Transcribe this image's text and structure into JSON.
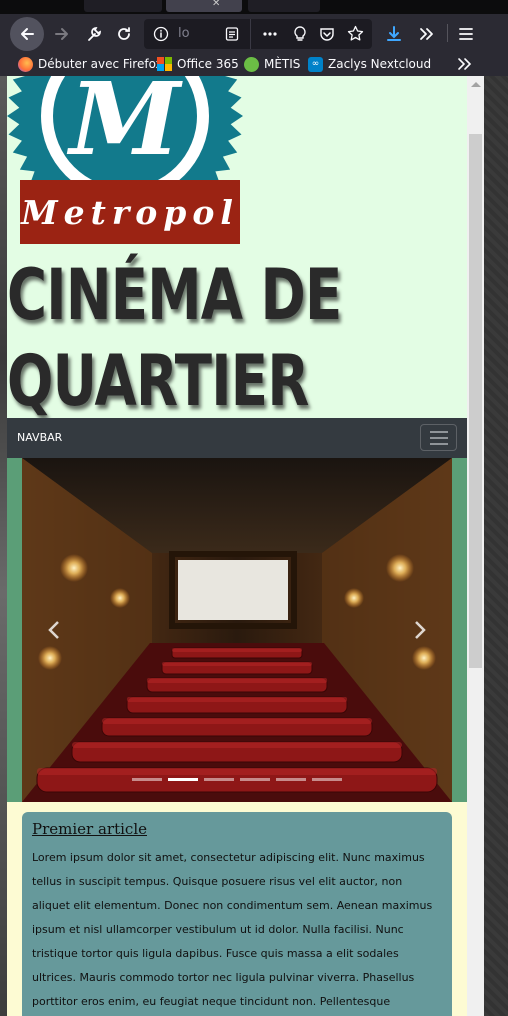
{
  "browser": {
    "url_text": "lo",
    "bookmarks": [
      {
        "label": "Débuter avec Firefox",
        "icon": "firefox-icon",
        "color": "#ff7139"
      },
      {
        "label": "Office 365",
        "icon": "office365-icon",
        "color": "#f25022"
      },
      {
        "label": "MÈTIS",
        "icon": "metis-icon",
        "color": "#6bbe45"
      },
      {
        "label": "Zaclys Nextcloud",
        "icon": "nextcloud-icon",
        "color": "#0082c9"
      }
    ]
  },
  "site": {
    "logo_letter": "M",
    "logo_name": "Metropol",
    "title_line1": "CINÉMA DE",
    "title_line2": "QUARTIER",
    "nav_brand": "NAVBAR",
    "carousel": {
      "slide_count": 6,
      "active_index": 1
    },
    "article": {
      "title": "Premier article",
      "body": "Lorem ipsum dolor sit amet, consectetur adipiscing elit. Nunc maximus tellus in suscipit tempus. Quisque posuere risus vel elit auctor, non aliquet elit elementum. Donec non condimentum sem. Aenean maximus ipsum et nisl ullamcorper vestibulum ut id dolor. Nulla facilisi. Nunc tristique tortor quis ligula dapibus. Fusce quis massa a elit sodales ultrices. Mauris commodo tortor nec ligula pulvinar viverra. Phasellus porttitor eros enim, eu feugiat neque tincidunt non. Pellentesque"
    }
  },
  "colors": {
    "page_bg": "#e3fde4",
    "logo_teal": "#127a8c",
    "logo_red": "#9b2313",
    "navbar": "#343a40",
    "carousel_frame": "#5b9e77",
    "article_card": "#66999b",
    "article_bg": "#fdfbd3",
    "download_blue": "#3fa7ff"
  }
}
